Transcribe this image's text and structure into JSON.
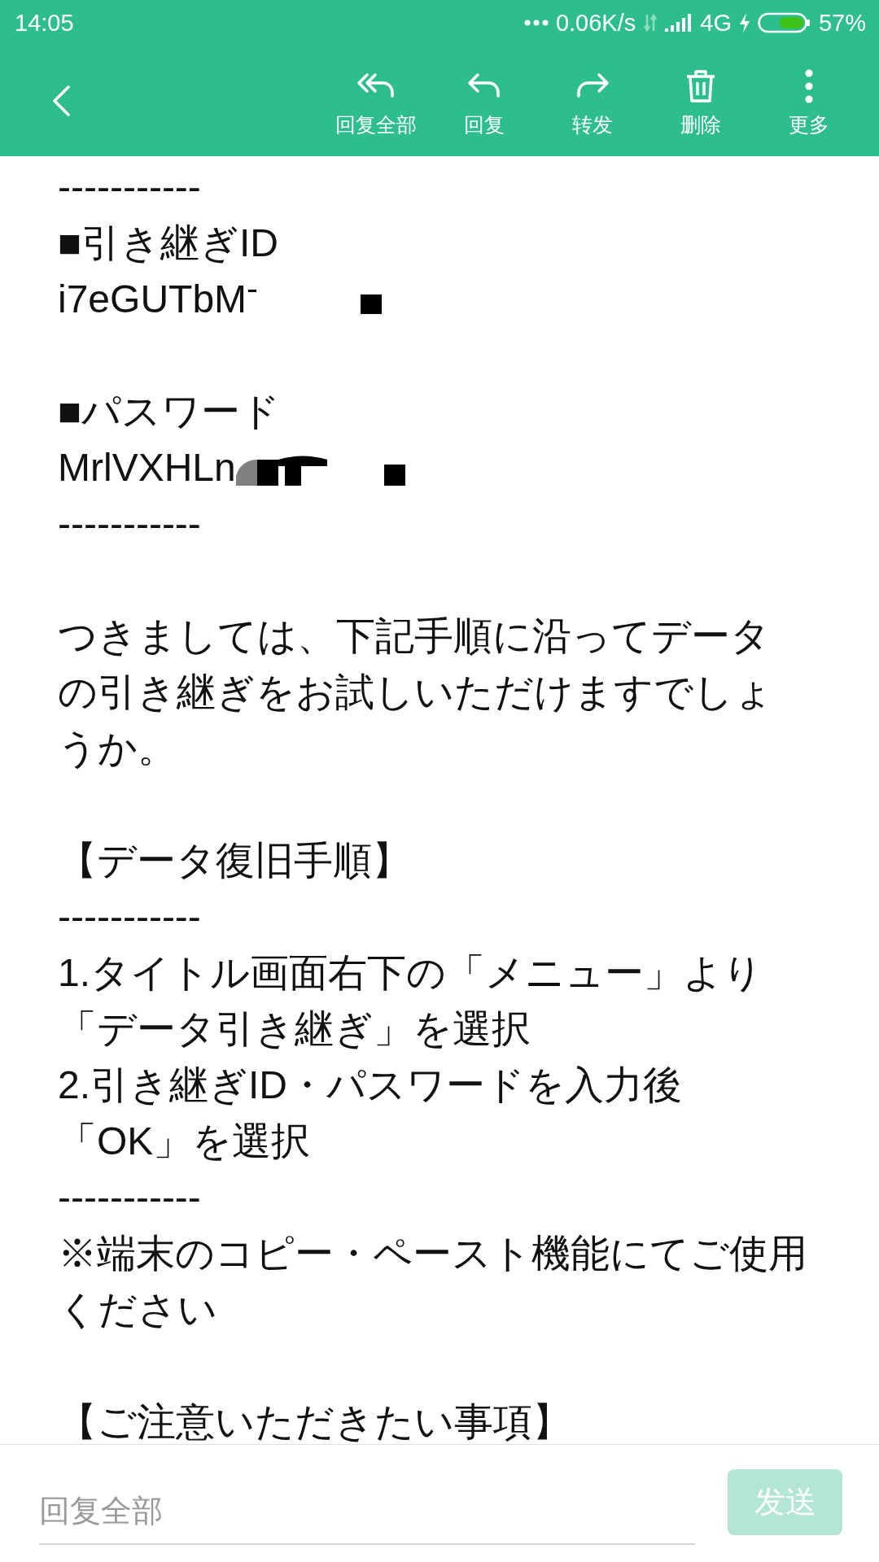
{
  "status_bar": {
    "time": "14:05",
    "network_speed": "0.06K/s",
    "network_type": "4G",
    "battery": "57%"
  },
  "toolbar": {
    "actions": [
      {
        "kind": "reply-all",
        "label": "回复全部"
      },
      {
        "kind": "reply",
        "label": "回复"
      },
      {
        "kind": "forward",
        "label": "转发"
      },
      {
        "kind": "delete",
        "label": "删除"
      },
      {
        "kind": "more",
        "label": "更多"
      }
    ]
  },
  "body": {
    "blocks": [
      {
        "lines": [
          {
            "kind": "rule",
            "text": "-----------"
          },
          {
            "kind": "text",
            "text": "■引き継ぎID"
          },
          {
            "kind": "masked",
            "text": "i7eGUTbM"
          }
        ]
      },
      {
        "lines": [
          {
            "kind": "text",
            "text": "■パスワード"
          },
          {
            "kind": "scribbled",
            "text": "MrlVXHLn"
          },
          {
            "kind": "rule",
            "text": "-----------"
          }
        ]
      },
      {
        "lines": [
          {
            "kind": "text",
            "text": "つきましては、下記手順に沿ってデータ"
          },
          {
            "kind": "text",
            "text": "の引き継ぎをお試しいただけますでしょ"
          },
          {
            "kind": "text",
            "text": "うか。"
          }
        ]
      },
      {
        "lines": [
          {
            "kind": "text",
            "text": "【データ復旧手順】"
          },
          {
            "kind": "rule",
            "text": "-----------"
          },
          {
            "kind": "text",
            "text": "1.タイトル画面右下の「メニュー」より"
          },
          {
            "kind": "text",
            "text": "「データ引き継ぎ」を選択"
          },
          {
            "kind": "text",
            "text": "2.引き継ぎID・パスワードを入力後"
          },
          {
            "kind": "text",
            "text": "「OK」を選択"
          },
          {
            "kind": "rule",
            "text": "-----------"
          },
          {
            "kind": "text",
            "text": "※端末のコピー・ペースト機能にてご使用"
          },
          {
            "kind": "text",
            "text": "ください"
          }
        ]
      },
      {
        "lines": [
          {
            "kind": "text",
            "text": "【ご注意いただきたい事項】"
          }
        ]
      }
    ]
  },
  "reply_bar": {
    "placeholder": "回复全部",
    "send_button": {
      "label": "发送",
      "disabled": true
    }
  }
}
